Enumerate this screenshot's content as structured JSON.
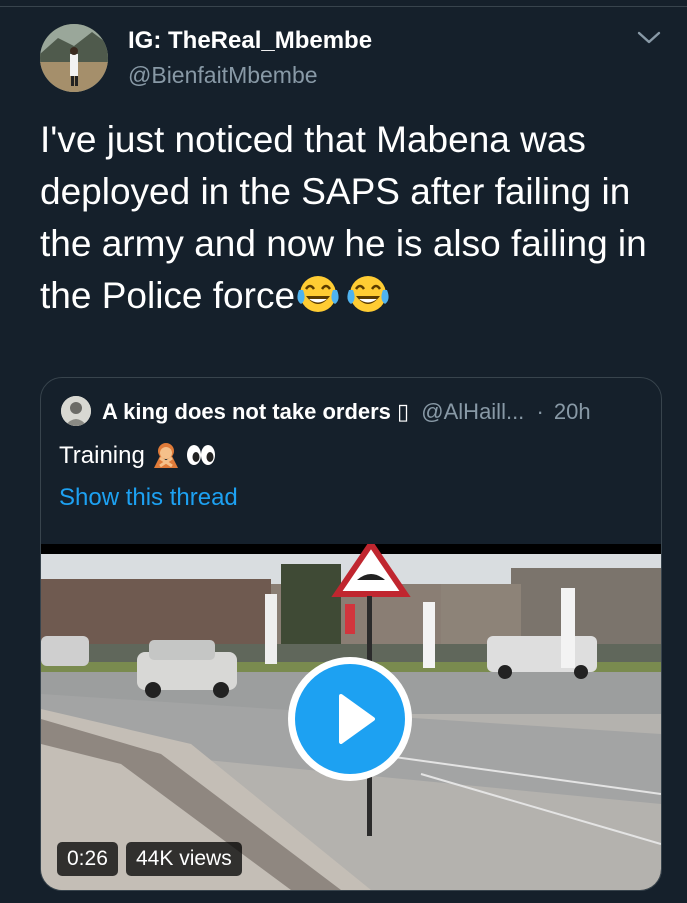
{
  "author": {
    "display_name": "IG: TheReal_Mbembe",
    "handle": "@BienfaitMbembe"
  },
  "tweet": {
    "text": "I've just noticed that Mabena was deployed in the SAPS after failing in the army and now he is also failing in the Police force",
    "emojis": [
      "face-with-tears-of-joy-icon",
      "face-with-tears-of-joy-icon"
    ]
  },
  "quoted": {
    "name": "A king does not take orders",
    "name_suffix_glyph": "▯",
    "handle": "@AlHaill...",
    "separator": "·",
    "time": "20h",
    "text": "Training",
    "text_emojis": [
      "woman-gesturing-no-icon",
      "eyes-icon"
    ],
    "link": "Show this thread",
    "video": {
      "duration": "0:26",
      "views": "44K views"
    }
  },
  "colors": {
    "background": "#15202b",
    "border": "#38444d",
    "secondary_text": "#8899a6",
    "link": "#1da1f2"
  }
}
